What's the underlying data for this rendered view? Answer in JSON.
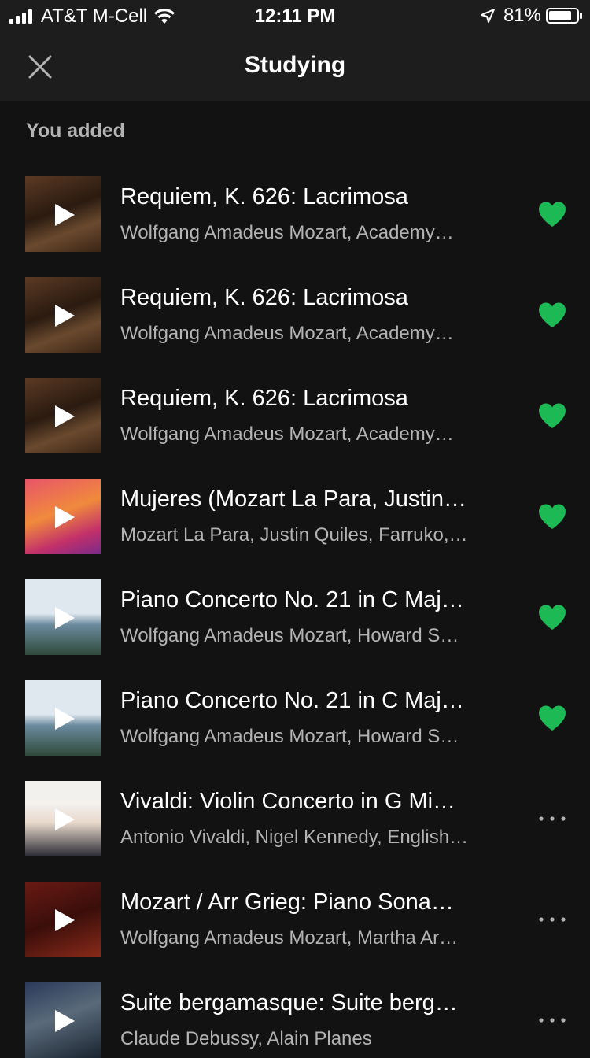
{
  "status": {
    "carrier": "AT&T M-Cell",
    "time": "12:11 PM",
    "battery": "81%",
    "battery_level": 0.81,
    "signal_bars": 4,
    "icons": [
      "signal-icon",
      "wifi-icon",
      "location-arrow-icon",
      "battery-icon"
    ]
  },
  "header": {
    "title": "Studying",
    "close_icon": "close-icon"
  },
  "section": {
    "heading": "You added"
  },
  "colors": {
    "background": "#121212",
    "header": "#1d1d1d",
    "accent_green": "#1db954",
    "secondary_text": "#b3b3b3"
  },
  "tracks": [
    {
      "title": "Requiem, K. 626: Lacrimosa",
      "artist": "Wolfgang Amadeus Mozart, Academy…",
      "action": "heart-icon",
      "art": "mozart-requiem"
    },
    {
      "title": "Requiem, K. 626: Lacrimosa",
      "artist": "Wolfgang Amadeus Mozart, Academy…",
      "action": "heart-icon",
      "art": "mozart-requiem"
    },
    {
      "title": "Requiem, K. 626: Lacrimosa",
      "artist": "Wolfgang Amadeus Mozart, Academy…",
      "action": "heart-icon",
      "art": "mozart-requiem"
    },
    {
      "title": "Mujeres (Mozart La Para, Justin…",
      "artist": "Mozart La Para, Justin Quiles, Farruko,…",
      "action": "heart-icon",
      "art": "mujeres"
    },
    {
      "title": "Piano Concerto No. 21 in C Maj…",
      "artist": "Wolfgang Amadeus Mozart, Howard S…",
      "action": "heart-icon",
      "art": "mozart-piano"
    },
    {
      "title": "Piano Concerto No. 21 in C Maj…",
      "artist": "Wolfgang Amadeus Mozart, Howard S…",
      "action": "heart-icon",
      "art": "mozart-piano"
    },
    {
      "title": "Vivaldi: Violin Concerto in G Mi…",
      "artist": "Antonio Vivaldi, Nigel Kennedy, English…",
      "action": "more-icon",
      "art": "vivaldi-four-seasons"
    },
    {
      "title": "Mozart / Arr Grieg: Piano Sona…",
      "artist": "Wolfgang Amadeus Mozart, Martha Ar…",
      "action": "more-icon",
      "art": "mozart-grieg"
    },
    {
      "title": "Suite bergamasque: Suite berg…",
      "artist": "Claude Debussy, Alain Planes",
      "action": "more-icon",
      "art": "debussy-suite"
    }
  ]
}
